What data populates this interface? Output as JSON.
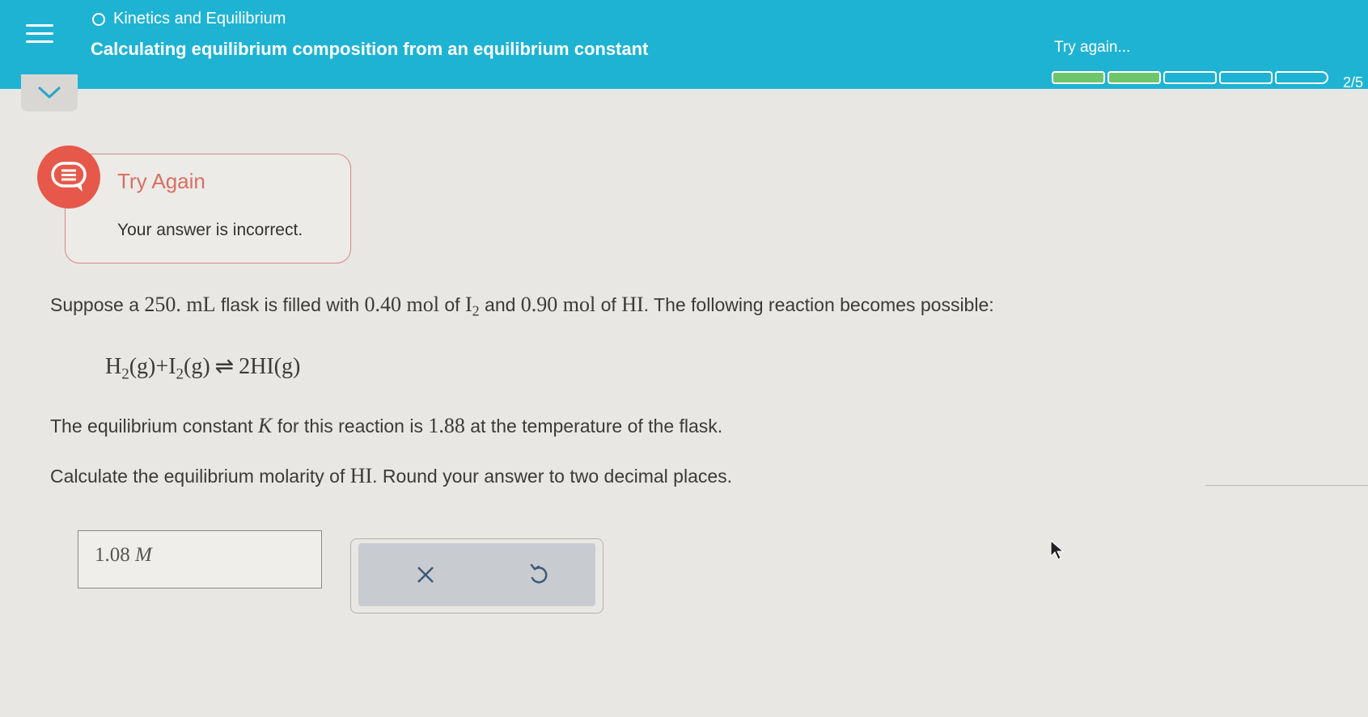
{
  "header": {
    "topic": "Kinetics and Equilibrium",
    "subtitle": "Calculating equilibrium composition from an equilibrium constant",
    "status": "Try again...",
    "progress": {
      "segments_total": 5,
      "segments_filled": 2,
      "label": "2/5"
    }
  },
  "feedback": {
    "title": "Try Again",
    "message": "Your answer is incorrect."
  },
  "question": {
    "line1": {
      "t1": "Suppose a ",
      "vol": "250. mL",
      "t2": " flask is filled with ",
      "mol1": "0.40 mol",
      "t3": " of ",
      "sp1": "I",
      "sp1_sub": "2",
      "t4": " and ",
      "mol2": "0.90 mol",
      "t5": " of ",
      "sp2": "HI",
      "t6": ". The following reaction becomes possible:"
    },
    "equation": {
      "h": "H",
      "h_sub": "2",
      "g1": "(g)+",
      "i": "I",
      "i_sub": "2",
      "g2": "(g)",
      "arrow": "⇌",
      "product": "2HI(g)"
    },
    "line3": {
      "t1": "The equilibrium constant ",
      "k": "K",
      "t2": " for this reaction is ",
      "kval": "1.88",
      "t3": " at the temperature of the flask."
    },
    "line4": {
      "t1": "Calculate the equilibrium molarity of ",
      "sp": "HI",
      "t2": ". Round your answer to two decimal places."
    }
  },
  "answer": {
    "value": "1.08",
    "unit": "M"
  },
  "colors": {
    "header": "#1fb3d3",
    "progress_fill": "#6ec66a",
    "error": "#e6594a"
  }
}
